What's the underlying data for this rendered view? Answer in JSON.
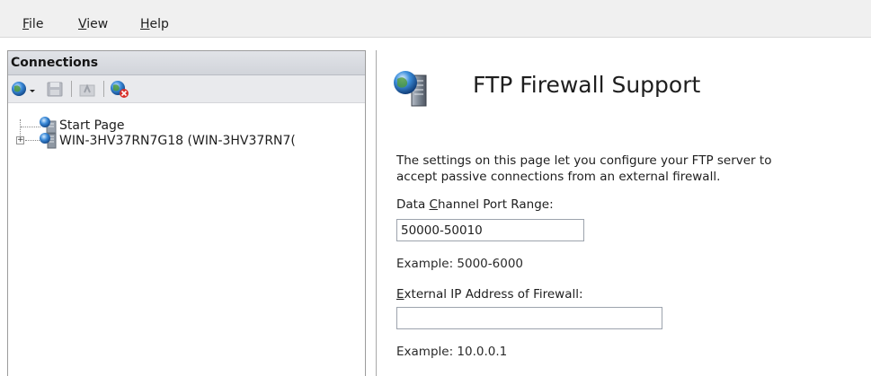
{
  "menu": {
    "file": {
      "prefix": "",
      "accel": "F",
      "rest": "ile"
    },
    "view": {
      "prefix": "",
      "accel": "V",
      "rest": "iew"
    },
    "help": {
      "prefix": "",
      "accel": "H",
      "rest": "elp"
    }
  },
  "connections": {
    "title": "Connections",
    "toolbar": {
      "icons": [
        "connect-icon",
        "dropdown-arrow-icon",
        "save-icon",
        "up-icon",
        "disconnect-icon"
      ]
    },
    "tree": [
      {
        "label": "Start Page",
        "icon": "start-page-icon"
      },
      {
        "label": "WIN-3HV37RN7G18 (WIN-3HV37RN7(",
        "icon": "server-icon",
        "expander": "+"
      }
    ]
  },
  "page": {
    "title": "FTP Firewall Support",
    "icon": "ftp-firewall-icon",
    "description_line1": "The settings on this page let you configure your FTP server to",
    "description_line2": "accept passive connections from an external firewall.",
    "port_range": {
      "label_prefix": "Data ",
      "label_accel": "C",
      "label_rest": "hannel Port Range:",
      "value": "50000-50010",
      "example": "Example: 5000-6000"
    },
    "external_ip": {
      "label_prefix": "",
      "label_accel": "E",
      "label_rest": "xternal IP Address of Firewall:",
      "value": "",
      "example": "Example: 10.0.0.1"
    }
  }
}
